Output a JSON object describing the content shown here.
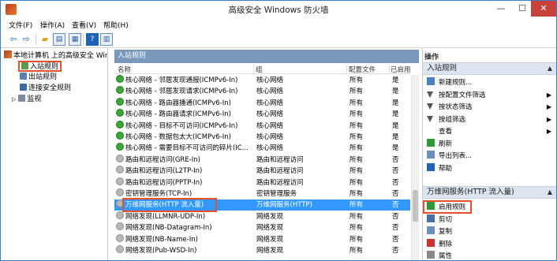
{
  "window": {
    "title": "高级安全 Windows 防火墙",
    "min": "—",
    "max": "☐",
    "close": "✕"
  },
  "menu": [
    "文件(F)",
    "操作(A)",
    "查看(V)",
    "帮助(H)"
  ],
  "toolbar": {
    "help": "?"
  },
  "tree": {
    "root": "本地计算机 上的高级安全 Windows",
    "inbound": "入站规则",
    "outbound": "出站规则",
    "connsec": "连接安全规则",
    "monitor": "监视"
  },
  "center": {
    "header": "入站规则",
    "columns": {
      "name": "名称",
      "group": "组",
      "profile": "配置文件",
      "enabled": "已启用"
    },
    "rows": [
      {
        "name": "核心网络 - 邻居发现通报(ICMPv6-In)",
        "group": "核心网络",
        "profile": "所有",
        "enabled": "是",
        "state": "on"
      },
      {
        "name": "核心网络 - 邻居发现请求(ICMPv6-In)",
        "group": "核心网络",
        "profile": "所有",
        "enabled": "是",
        "state": "on"
      },
      {
        "name": "核心网络 - 路由器播通(ICMPv6-In)",
        "group": "核心网络",
        "profile": "所有",
        "enabled": "是",
        "state": "on"
      },
      {
        "name": "核心网络 - 路由器请求(ICMPv6-In)",
        "group": "核心网络",
        "profile": "所有",
        "enabled": "是",
        "state": "on"
      },
      {
        "name": "核心网络 - 目标不可访问(ICMPv6-In)",
        "group": "核心网络",
        "profile": "所有",
        "enabled": "是",
        "state": "on"
      },
      {
        "name": "核心网络 - 数据包太大(ICMPv6-In)",
        "group": "核心网络",
        "profile": "所有",
        "enabled": "是",
        "state": "on"
      },
      {
        "name": "核心网络 - 需要目标不可访问的碎片(IC...",
        "group": "核心网络",
        "profile": "所有",
        "enabled": "是",
        "state": "on"
      },
      {
        "name": "路由和远程访问(GRE-In)",
        "group": "路由和远程访问",
        "profile": "所有",
        "enabled": "否",
        "state": "off"
      },
      {
        "name": "路由和远程访问(L2TP-In)",
        "group": "路由和远程访问",
        "profile": "所有",
        "enabled": "否",
        "state": "off"
      },
      {
        "name": "路由和远程访问(PPTP-In)",
        "group": "路由和远程访问",
        "profile": "所有",
        "enabled": "否",
        "state": "off"
      },
      {
        "name": "密钥管理服务(TCP-In)",
        "group": "密钥管理服务",
        "profile": "所有",
        "enabled": "否",
        "state": "off"
      },
      {
        "name": "万维网服务(HTTP 流入量)",
        "group": "万维网服务(HTTP)",
        "profile": "所有",
        "enabled": "否",
        "state": "off",
        "selected": true
      },
      {
        "name": "网络发现(LLMNR-UDP-In)",
        "group": "网络发现",
        "profile": "所有",
        "enabled": "否",
        "state": "off"
      },
      {
        "name": "网络发现(NB-Datagram-In)",
        "group": "网络发现",
        "profile": "所有",
        "enabled": "否",
        "state": "off"
      },
      {
        "name": "网络发现(NB-Name-In)",
        "group": "网络发现",
        "profile": "所有",
        "enabled": "否",
        "state": "off"
      },
      {
        "name": "网络发现(Pub-WSD-In)",
        "group": "网络发现",
        "profile": "所有",
        "enabled": "否",
        "state": "off"
      }
    ]
  },
  "actions": {
    "title": "操作",
    "section1": "入站规则",
    "items1": [
      {
        "label": "新建规则...",
        "icon": "new-rule-icon",
        "color": "#4a7fc0"
      },
      {
        "label": "按配置文件筛选",
        "icon": "filter-icon",
        "color": "#555555",
        "submenu": true
      },
      {
        "label": "按状态筛选",
        "icon": "filter-icon",
        "color": "#555555",
        "submenu": true
      },
      {
        "label": "按组筛选",
        "icon": "filter-icon",
        "color": "#555555",
        "submenu": true
      },
      {
        "label": "查看",
        "icon": "view-icon",
        "color": "#ffffff",
        "submenu": true
      },
      {
        "label": "刷新",
        "icon": "refresh-icon",
        "color": "#2e9a3a"
      },
      {
        "label": "导出列表...",
        "icon": "export-icon",
        "color": "#6a8fbf"
      },
      {
        "label": "帮助",
        "icon": "help-icon",
        "color": "#1e63b8"
      }
    ],
    "section2": "万维网服务(HTTP 流入量)",
    "items2": [
      {
        "label": "启用规则",
        "icon": "enable-icon",
        "color": "#2e9a3a"
      },
      {
        "label": "剪切",
        "icon": "cut-icon",
        "color": "#4a6fa5"
      },
      {
        "label": "复制",
        "icon": "copy-icon",
        "color": "#6a8fbf"
      },
      {
        "label": "删除",
        "icon": "delete-icon",
        "color": "#d03030"
      },
      {
        "label": "属性",
        "icon": "properties-icon",
        "color": "#888888"
      }
    ]
  }
}
